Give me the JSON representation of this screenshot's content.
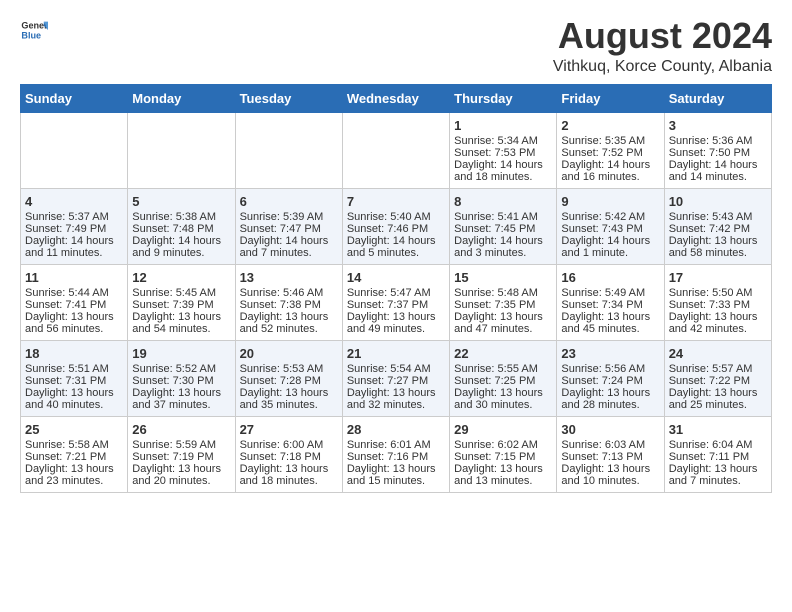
{
  "header": {
    "logo_general": "General",
    "logo_blue": "Blue",
    "main_title": "August 2024",
    "subtitle": "Vithkuq, Korce County, Albania"
  },
  "days_of_week": [
    "Sunday",
    "Monday",
    "Tuesday",
    "Wednesday",
    "Thursday",
    "Friday",
    "Saturday"
  ],
  "weeks": [
    [
      {
        "day": "",
        "empty": true
      },
      {
        "day": "",
        "empty": true
      },
      {
        "day": "",
        "empty": true
      },
      {
        "day": "",
        "empty": true
      },
      {
        "day": "1",
        "sunrise": "Sunrise: 5:34 AM",
        "sunset": "Sunset: 7:53 PM",
        "daylight": "Daylight: 14 hours and 18 minutes."
      },
      {
        "day": "2",
        "sunrise": "Sunrise: 5:35 AM",
        "sunset": "Sunset: 7:52 PM",
        "daylight": "Daylight: 14 hours and 16 minutes."
      },
      {
        "day": "3",
        "sunrise": "Sunrise: 5:36 AM",
        "sunset": "Sunset: 7:50 PM",
        "daylight": "Daylight: 14 hours and 14 minutes."
      }
    ],
    [
      {
        "day": "4",
        "sunrise": "Sunrise: 5:37 AM",
        "sunset": "Sunset: 7:49 PM",
        "daylight": "Daylight: 14 hours and 11 minutes."
      },
      {
        "day": "5",
        "sunrise": "Sunrise: 5:38 AM",
        "sunset": "Sunset: 7:48 PM",
        "daylight": "Daylight: 14 hours and 9 minutes."
      },
      {
        "day": "6",
        "sunrise": "Sunrise: 5:39 AM",
        "sunset": "Sunset: 7:47 PM",
        "daylight": "Daylight: 14 hours and 7 minutes."
      },
      {
        "day": "7",
        "sunrise": "Sunrise: 5:40 AM",
        "sunset": "Sunset: 7:46 PM",
        "daylight": "Daylight: 14 hours and 5 minutes."
      },
      {
        "day": "8",
        "sunrise": "Sunrise: 5:41 AM",
        "sunset": "Sunset: 7:45 PM",
        "daylight": "Daylight: 14 hours and 3 minutes."
      },
      {
        "day": "9",
        "sunrise": "Sunrise: 5:42 AM",
        "sunset": "Sunset: 7:43 PM",
        "daylight": "Daylight: 14 hours and 1 minute."
      },
      {
        "day": "10",
        "sunrise": "Sunrise: 5:43 AM",
        "sunset": "Sunset: 7:42 PM",
        "daylight": "Daylight: 13 hours and 58 minutes."
      }
    ],
    [
      {
        "day": "11",
        "sunrise": "Sunrise: 5:44 AM",
        "sunset": "Sunset: 7:41 PM",
        "daylight": "Daylight: 13 hours and 56 minutes."
      },
      {
        "day": "12",
        "sunrise": "Sunrise: 5:45 AM",
        "sunset": "Sunset: 7:39 PM",
        "daylight": "Daylight: 13 hours and 54 minutes."
      },
      {
        "day": "13",
        "sunrise": "Sunrise: 5:46 AM",
        "sunset": "Sunset: 7:38 PM",
        "daylight": "Daylight: 13 hours and 52 minutes."
      },
      {
        "day": "14",
        "sunrise": "Sunrise: 5:47 AM",
        "sunset": "Sunset: 7:37 PM",
        "daylight": "Daylight: 13 hours and 49 minutes."
      },
      {
        "day": "15",
        "sunrise": "Sunrise: 5:48 AM",
        "sunset": "Sunset: 7:35 PM",
        "daylight": "Daylight: 13 hours and 47 minutes."
      },
      {
        "day": "16",
        "sunrise": "Sunrise: 5:49 AM",
        "sunset": "Sunset: 7:34 PM",
        "daylight": "Daylight: 13 hours and 45 minutes."
      },
      {
        "day": "17",
        "sunrise": "Sunrise: 5:50 AM",
        "sunset": "Sunset: 7:33 PM",
        "daylight": "Daylight: 13 hours and 42 minutes."
      }
    ],
    [
      {
        "day": "18",
        "sunrise": "Sunrise: 5:51 AM",
        "sunset": "Sunset: 7:31 PM",
        "daylight": "Daylight: 13 hours and 40 minutes."
      },
      {
        "day": "19",
        "sunrise": "Sunrise: 5:52 AM",
        "sunset": "Sunset: 7:30 PM",
        "daylight": "Daylight: 13 hours and 37 minutes."
      },
      {
        "day": "20",
        "sunrise": "Sunrise: 5:53 AM",
        "sunset": "Sunset: 7:28 PM",
        "daylight": "Daylight: 13 hours and 35 minutes."
      },
      {
        "day": "21",
        "sunrise": "Sunrise: 5:54 AM",
        "sunset": "Sunset: 7:27 PM",
        "daylight": "Daylight: 13 hours and 32 minutes."
      },
      {
        "day": "22",
        "sunrise": "Sunrise: 5:55 AM",
        "sunset": "Sunset: 7:25 PM",
        "daylight": "Daylight: 13 hours and 30 minutes."
      },
      {
        "day": "23",
        "sunrise": "Sunrise: 5:56 AM",
        "sunset": "Sunset: 7:24 PM",
        "daylight": "Daylight: 13 hours and 28 minutes."
      },
      {
        "day": "24",
        "sunrise": "Sunrise: 5:57 AM",
        "sunset": "Sunset: 7:22 PM",
        "daylight": "Daylight: 13 hours and 25 minutes."
      }
    ],
    [
      {
        "day": "25",
        "sunrise": "Sunrise: 5:58 AM",
        "sunset": "Sunset: 7:21 PM",
        "daylight": "Daylight: 13 hours and 23 minutes."
      },
      {
        "day": "26",
        "sunrise": "Sunrise: 5:59 AM",
        "sunset": "Sunset: 7:19 PM",
        "daylight": "Daylight: 13 hours and 20 minutes."
      },
      {
        "day": "27",
        "sunrise": "Sunrise: 6:00 AM",
        "sunset": "Sunset: 7:18 PM",
        "daylight": "Daylight: 13 hours and 18 minutes."
      },
      {
        "day": "28",
        "sunrise": "Sunrise: 6:01 AM",
        "sunset": "Sunset: 7:16 PM",
        "daylight": "Daylight: 13 hours and 15 minutes."
      },
      {
        "day": "29",
        "sunrise": "Sunrise: 6:02 AM",
        "sunset": "Sunset: 7:15 PM",
        "daylight": "Daylight: 13 hours and 13 minutes."
      },
      {
        "day": "30",
        "sunrise": "Sunrise: 6:03 AM",
        "sunset": "Sunset: 7:13 PM",
        "daylight": "Daylight: 13 hours and 10 minutes."
      },
      {
        "day": "31",
        "sunrise": "Sunrise: 6:04 AM",
        "sunset": "Sunset: 7:11 PM",
        "daylight": "Daylight: 13 hours and 7 minutes."
      }
    ]
  ]
}
